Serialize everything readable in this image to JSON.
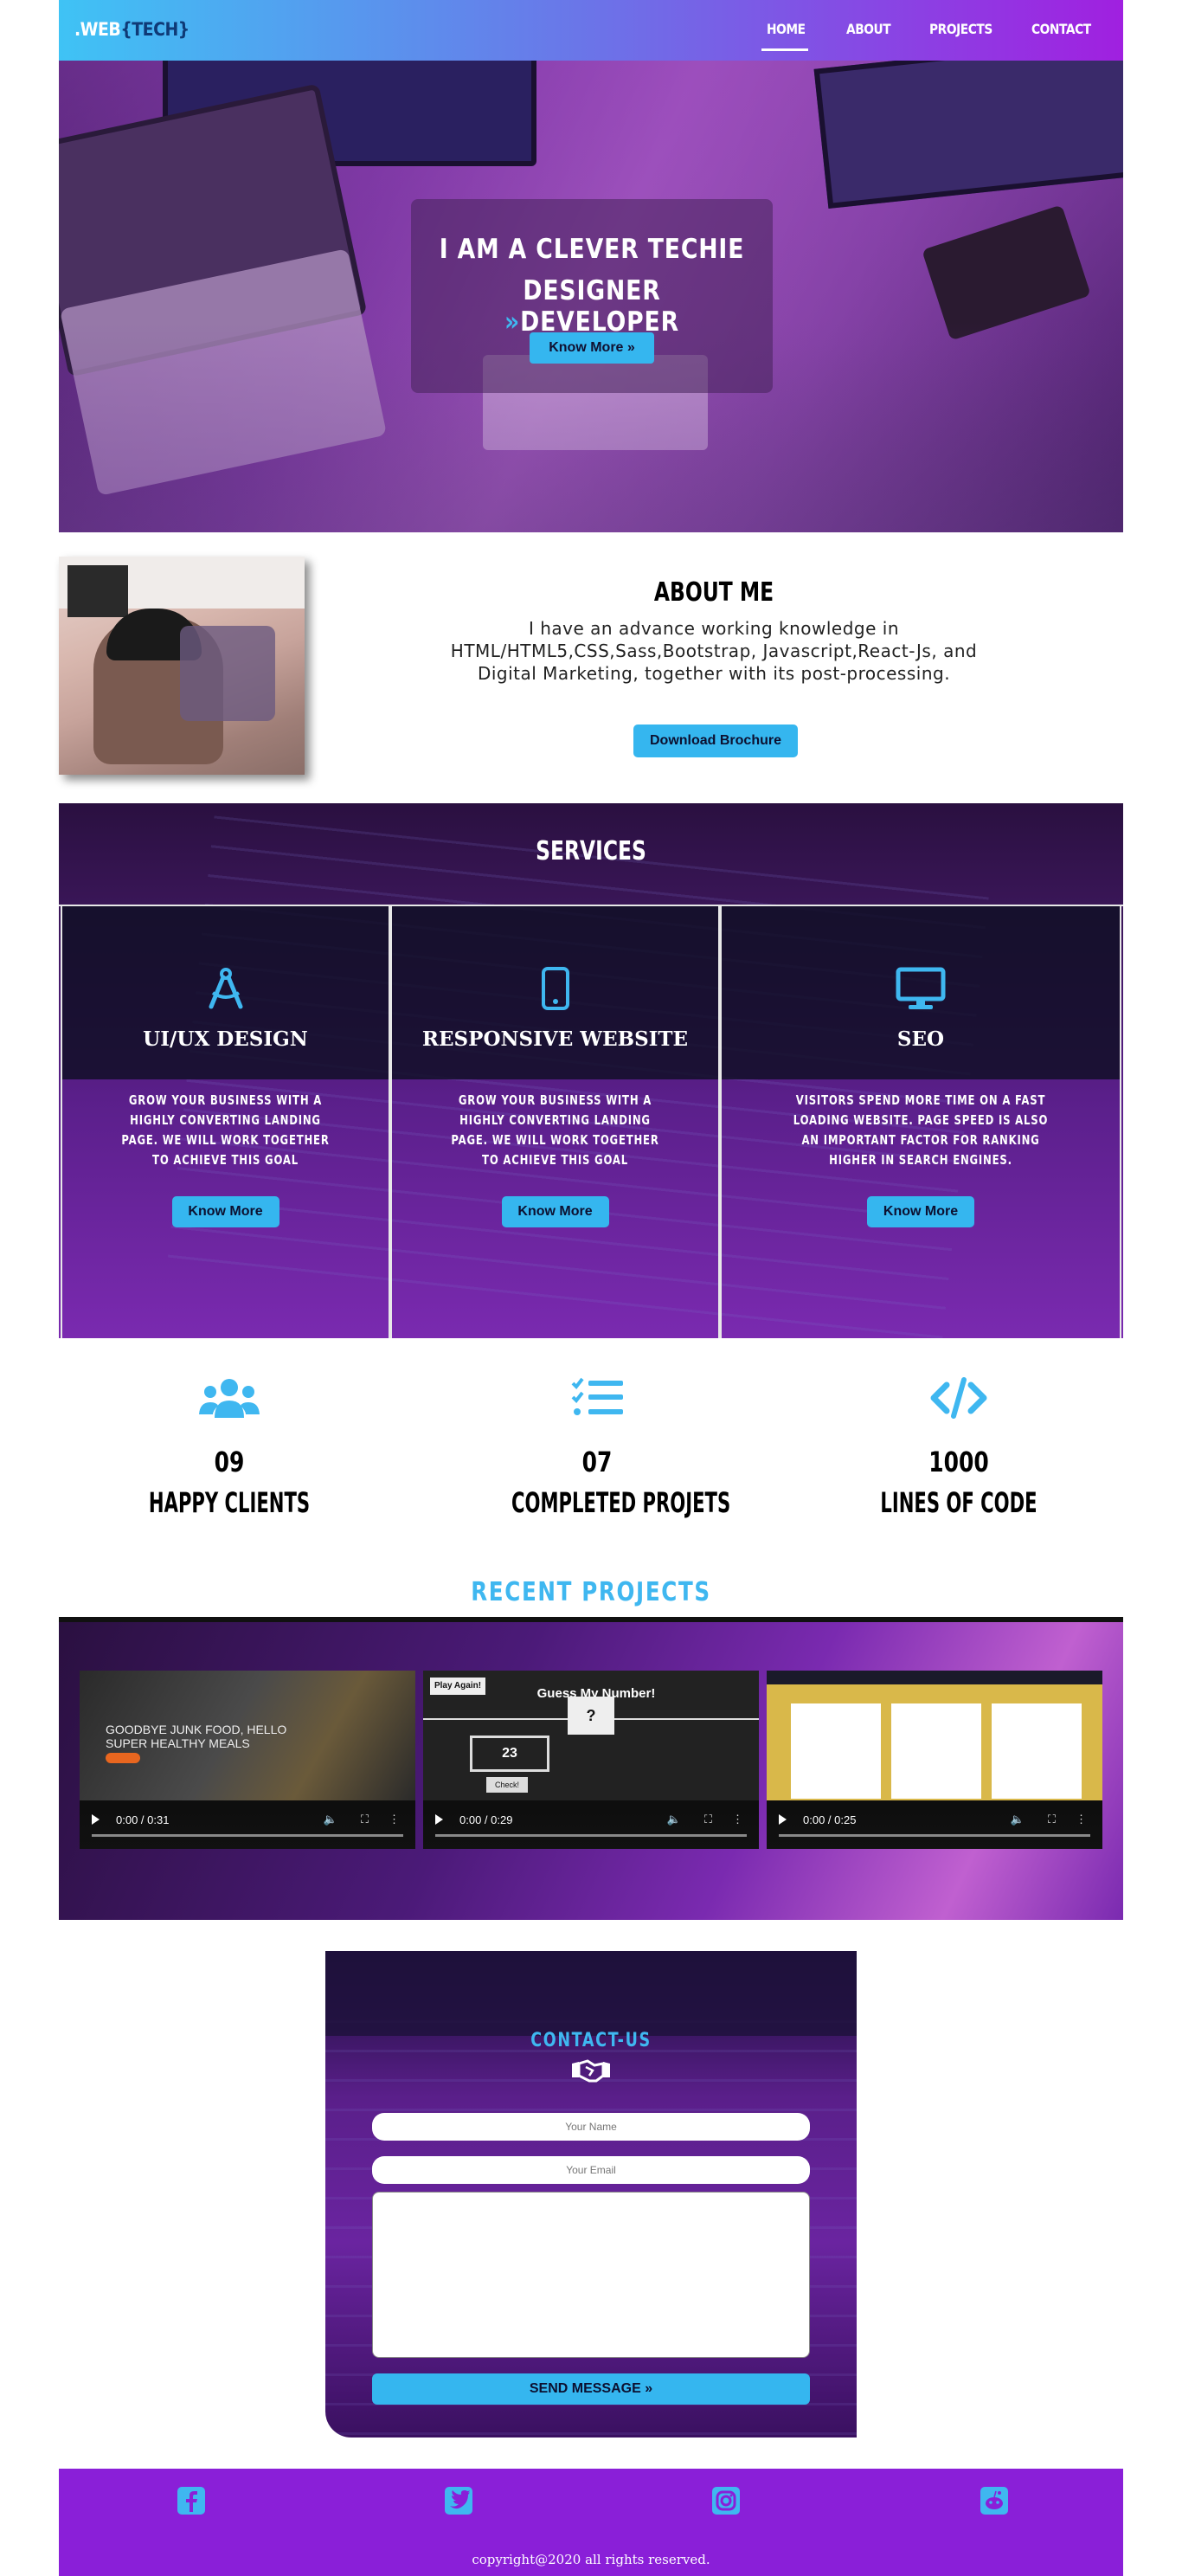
{
  "nav": {
    "brand_a": ".WEB",
    "brand_b": "{TECH}",
    "links": [
      "HOME",
      "ABOUT",
      "PROJECTS",
      "CONTACT"
    ]
  },
  "hero": {
    "line1": "I AM A CLEVER TECHIE",
    "line2_a": "DESIGNER",
    "line2_sep": "»",
    "line2_b": "DEVELOPER",
    "button": "Know More »"
  },
  "about": {
    "title": "ABOUT ME",
    "text": "I have an advance working knowledge in HTML/HTML5,CSS,Sass,Bootstrap, Javascript,React-Js, and Digital Marketing, together with its post-processing.",
    "button": "Download Brochure"
  },
  "services": {
    "title": "SERVICES",
    "cards": [
      {
        "icon": "compass-drafting-icon",
        "title": "UI/UX DESIGN",
        "text": "GROW YOUR BUSINESS WITH A HIGHLY CONVERTING LANDING PAGE. WE WILL WORK TOGETHER TO ACHIEVE THIS GOAL",
        "button": "Know More"
      },
      {
        "icon": "mobile-icon",
        "title": "RESPONSIVE WEBSITE",
        "text": "GROW YOUR BUSINESS WITH A HIGHLY CONVERTING LANDING PAGE. WE WILL WORK TOGETHER TO ACHIEVE THIS GOAL",
        "button": "Know More"
      },
      {
        "icon": "desktop-icon",
        "title": "SEO",
        "text": "VISITORS SPEND MORE TIME ON A FAST LOADING WEBSITE. PAGE SPEED IS ALSO AN IMPORTANT FACTOR FOR RANKING HIGHER IN SEARCH ENGINES.",
        "button": "Know More"
      }
    ]
  },
  "stats": [
    {
      "icon": "users-icon",
      "number": "09",
      "label": "HAPPY CLIENTS"
    },
    {
      "icon": "list-check-icon",
      "number": "07",
      "label": "COMPLETED PROJETS"
    },
    {
      "icon": "code-icon",
      "number": "1000",
      "label": "LINES OF CODE"
    }
  ],
  "projects": {
    "title": "RECENT PROJECTS",
    "videos": [
      {
        "time": "0:00 / 0:31",
        "caption": "GOODBYE JUNK FOOD, HELLO SUPER HEALTHY MEALS"
      },
      {
        "time": "0:00 / 0:29",
        "caption": "Guess My Number!",
        "btn": "Play Again!",
        "number": "23",
        "mystery": "?",
        "check": "Check!"
      },
      {
        "time": "0:00 / 0:25",
        "caption": ""
      }
    ]
  },
  "contact": {
    "title": "CONTACT-US",
    "name_placeholder": "Your Name",
    "email_placeholder": "Your Email",
    "button": "SEND MESSAGE »"
  },
  "footer": {
    "social": [
      "facebook-icon",
      "twitter-icon",
      "instagram-icon",
      "reddit-icon"
    ],
    "copyright": "copyright@2020 all rights reserved."
  },
  "colors": {
    "accent": "#35b6ef",
    "footer": "#8a1fd8",
    "nav_start": "#3fc3f5",
    "nav_end": "#a020e0"
  }
}
